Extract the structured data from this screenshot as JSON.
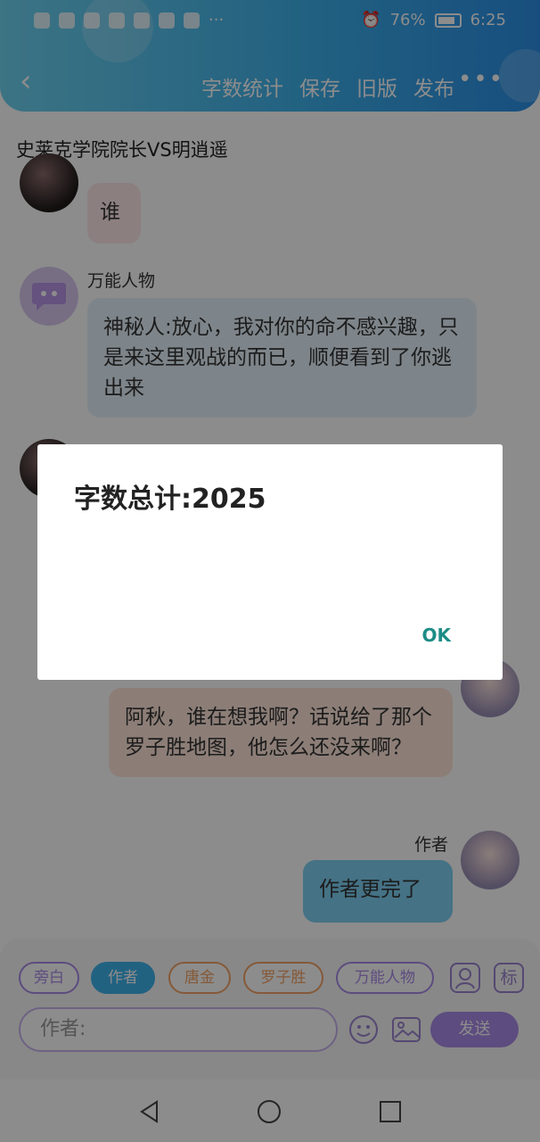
{
  "status_bar": {
    "battery": "76%",
    "time": "6:25"
  },
  "toolbar": {
    "word_count": "字数统计",
    "save": "保存",
    "old_version": "旧版",
    "publish": "发布",
    "more": "•••"
  },
  "story": {
    "title": "史莱克学院院长VS明逍遥"
  },
  "messages": [
    {
      "text": "谁"
    },
    {
      "name": "万能人物",
      "text": "神秘人:放心，我对你的命不感兴趣，只是来这里观战的而已，顺便看到了你逃出来"
    },
    {
      "text": "阿秋，谁在想我啊？话说给了那个罗子胜地图，他怎么还没来啊？"
    },
    {
      "name": "作者",
      "text": "作者更完了"
    }
  ],
  "roles": [
    "旁白",
    "作者",
    "唐金",
    "罗子胜",
    "万能人物"
  ],
  "role_icon_label": "标",
  "input": {
    "placeholder": "作者:"
  },
  "send": "发送",
  "dialog": {
    "message": "字数总计:2025",
    "ok": "OK"
  },
  "colors": {
    "accent": "#3fb2ec",
    "purple": "#a98be8",
    "ok": "#1e8c86"
  }
}
